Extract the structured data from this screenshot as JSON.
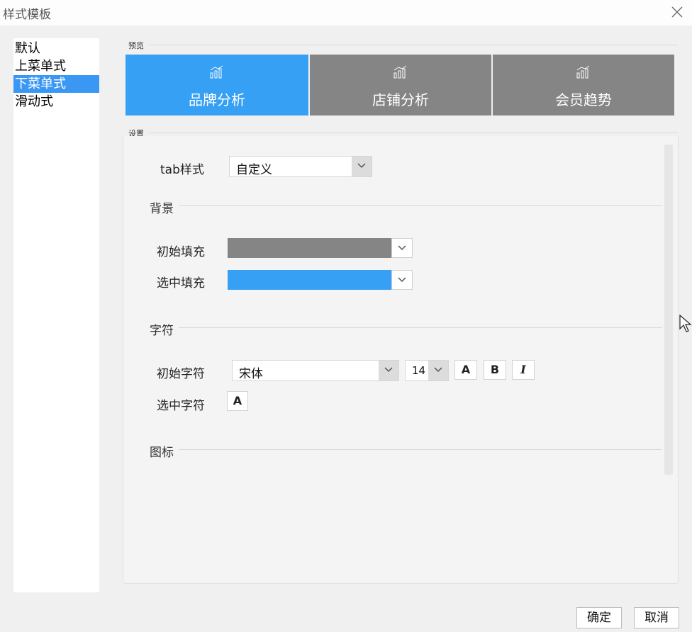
{
  "window": {
    "title": "样式模板"
  },
  "templates": {
    "items": [
      {
        "label": "默认"
      },
      {
        "label": "上菜单式"
      },
      {
        "label": "下菜单式"
      },
      {
        "label": "滑动式"
      }
    ],
    "selected_index": 2
  },
  "preview": {
    "group_label": "预览",
    "tabs": [
      {
        "label": "品牌分析",
        "icon": "bar-chart-icon",
        "active": true
      },
      {
        "label": "店铺分析",
        "icon": "bar-chart-icon",
        "active": false
      },
      {
        "label": "会员趋势",
        "icon": "bar-chart-icon",
        "active": false
      }
    ]
  },
  "settings": {
    "group_label": "设置",
    "tab_style": {
      "label": "tab样式",
      "value": "自定义"
    },
    "background": {
      "title": "背景",
      "initial_fill": {
        "label": "初始填充",
        "color": "#858585"
      },
      "selected_fill": {
        "label": "选中填充",
        "color": "#36a0f5"
      }
    },
    "font": {
      "title": "字符",
      "initial": {
        "label": "初始字符",
        "family": "宋体",
        "size": "14",
        "color_btn": "A",
        "bold_btn": "B",
        "italic_btn": "I"
      },
      "selected": {
        "label": "选中字符",
        "color_btn": "A"
      }
    },
    "icon_section": {
      "title": "图标"
    }
  },
  "buttons": {
    "ok": "确定",
    "cancel": "取消"
  },
  "colors": {
    "accent": "#3b97f4",
    "tab_active": "#36a0f5",
    "tab_inactive": "#858585"
  }
}
